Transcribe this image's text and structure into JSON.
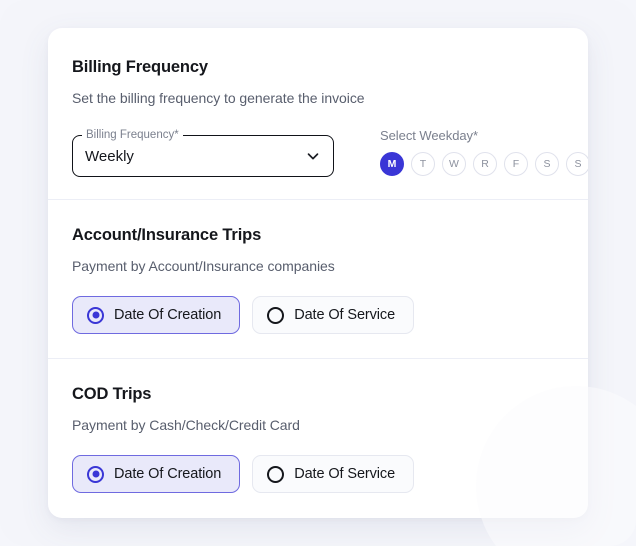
{
  "theme": {
    "accent": "#3a36d6",
    "accent_soft_bg": "#e9e9fa",
    "accent_soft_border": "#6f6ae0",
    "page_bg": "#f4f5fa",
    "card_bg": "#ffffff",
    "divider": "#eceef6",
    "title_color": "#15171c",
    "subtitle_color": "#585e6d",
    "muted_color": "#7b808e"
  },
  "billing_frequency": {
    "title": "Billing Frequency",
    "subtitle": "Set the billing frequency to generate the invoice",
    "select": {
      "legend": "Billing Frequency*",
      "value": "Weekly",
      "icon": "chevron-down-icon"
    },
    "weekday": {
      "label": "Select Weekday*",
      "days": [
        {
          "letter": "M",
          "selected": true
        },
        {
          "letter": "T",
          "selected": false
        },
        {
          "letter": "W",
          "selected": false
        },
        {
          "letter": "R",
          "selected": false
        },
        {
          "letter": "F",
          "selected": false
        },
        {
          "letter": "S",
          "selected": false
        },
        {
          "letter": "S",
          "selected": false
        }
      ]
    }
  },
  "account_insurance_trips": {
    "title": "Account/Insurance Trips",
    "subtitle": "Payment by Account/Insurance companies",
    "options": [
      {
        "label": "Date Of Creation",
        "selected": true
      },
      {
        "label": "Date Of Service",
        "selected": false
      }
    ]
  },
  "cod_trips": {
    "title": "COD Trips",
    "subtitle": "Payment by Cash/Check/Credit Card",
    "options": [
      {
        "label": "Date Of Creation",
        "selected": true
      },
      {
        "label": "Date Of Service",
        "selected": false
      }
    ]
  }
}
